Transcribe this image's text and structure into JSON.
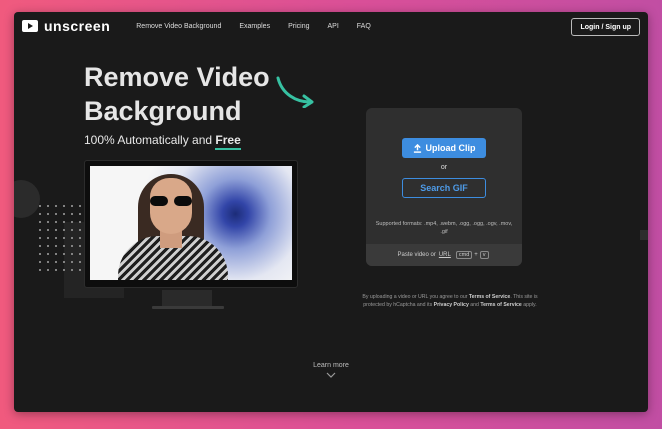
{
  "header": {
    "brand": "unscreen",
    "nav": [
      "Remove Video Background",
      "Examples",
      "Pricing",
      "API",
      "FAQ"
    ],
    "login_label": "Login / Sign up"
  },
  "hero": {
    "title_line1": "Remove Video",
    "title_line2": "Background",
    "subtitle_prefix": "100% Automatically and ",
    "subtitle_highlight": "Free",
    "accent_color": "#37c1a2"
  },
  "upload_card": {
    "upload_label": "Upload Clip",
    "or_label": "or",
    "search_label": "Search GIF",
    "formats": "Supported formats: .mp4, .webm, .ogg, .ogg, .ogv, .mov, .gif",
    "paste_prefix": "Paste video or",
    "paste_url": "URL",
    "key_cmd": "cmd",
    "key_plus": "+",
    "key_v": "v",
    "button_color": "#3d8de0"
  },
  "terms": {
    "part1": "By uploading a video or URL you agree to our ",
    "tos": "Terms of Service",
    "part2": ". This site is protected by hCaptcha and its ",
    "privacy": "Privacy Policy",
    "part3": " and ",
    "tos2": "Terms of Service",
    "part4": " apply."
  },
  "footer": {
    "learn_more": "Learn more"
  }
}
